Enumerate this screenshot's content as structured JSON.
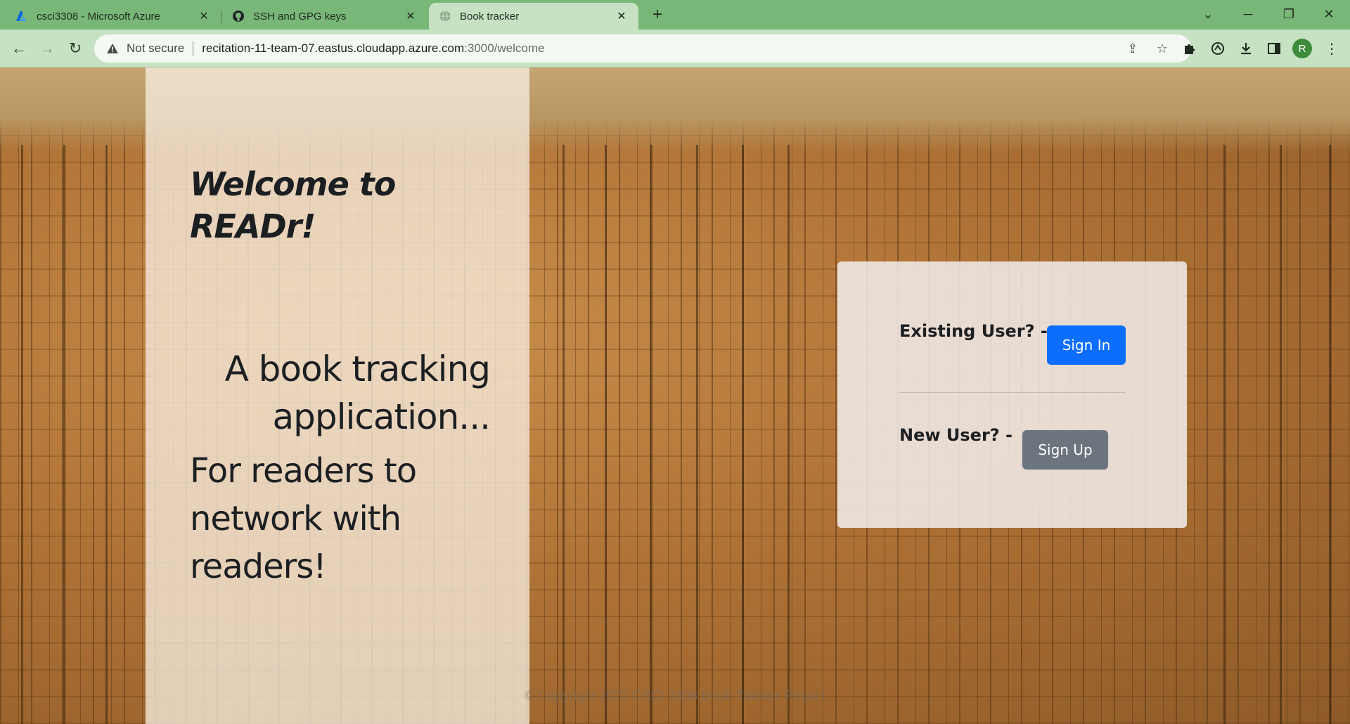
{
  "browser": {
    "tabs": [
      {
        "title": "csci3308 - Microsoft Azure",
        "icon": "azure-icon"
      },
      {
        "title": "SSH and GPG keys",
        "icon": "github-icon"
      },
      {
        "title": "Book tracker",
        "icon": "globe-icon",
        "active": true
      }
    ],
    "security_label": "Not secure",
    "url_host": "recitation-11-team-07.eastus.cloudapp.azure.com",
    "url_path": ":3000/welcome",
    "profile_initial": "R"
  },
  "page": {
    "welcome_title": "Welcome to READr!",
    "tagline": "A book tracking application...",
    "subline": "For readers to network with readers!",
    "existing_user_label": "Existing User? -",
    "sign_in_label": "Sign In",
    "new_user_label": "New User? -",
    "sign_up_label": "Sign Up",
    "footer": "© Copyright 2022 CSCI 3308 Book Tracker Project"
  },
  "colors": {
    "primary_button": "#0d6efd",
    "secondary_button": "#6c757d",
    "browser_frame": "#79b779"
  }
}
